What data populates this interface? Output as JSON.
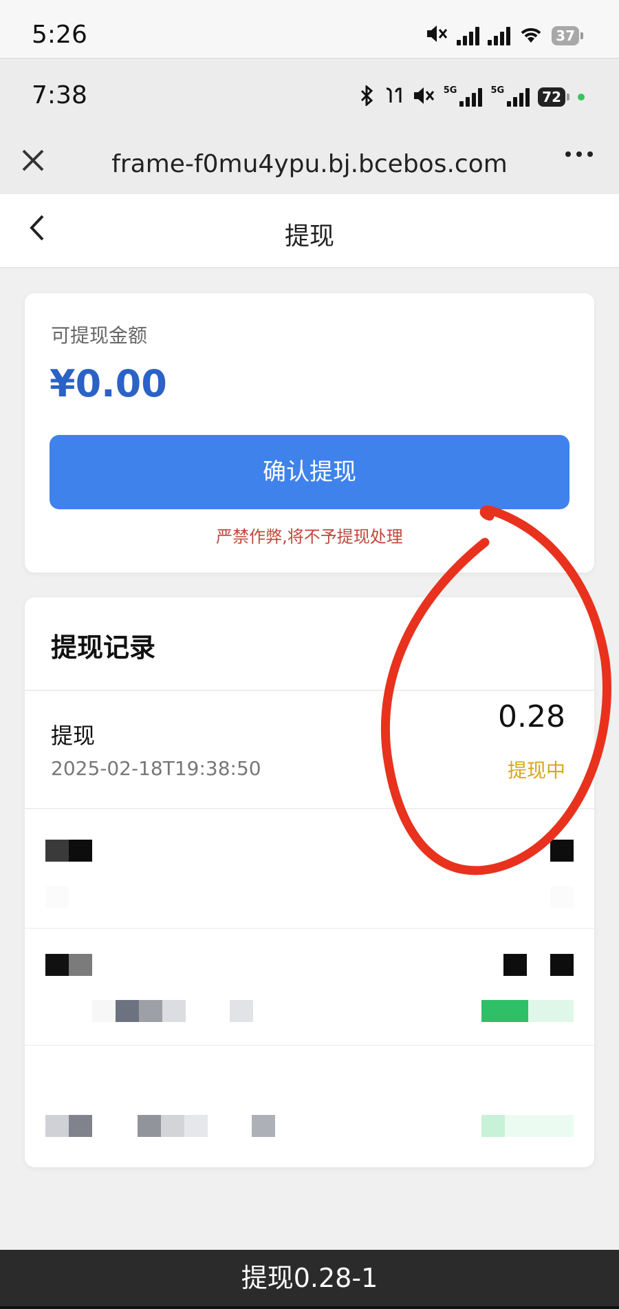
{
  "outer_status": {
    "time": "5:26",
    "battery": "37"
  },
  "inner_status": {
    "time": "7:38",
    "battery": "72",
    "network_1": "5G",
    "network_2": "5G"
  },
  "browser": {
    "url": "frame-f0mu4ypu.bj.bcebos.com",
    "more_icon": "more-icon",
    "close_icon": "close-icon"
  },
  "page": {
    "title": "提现",
    "back_icon": "chevron-left-icon"
  },
  "balance": {
    "label": "可提现金额",
    "amount": "¥0.00",
    "confirm_label": "确认提现",
    "warning": "严禁作弊,将不予提现处理"
  },
  "records": {
    "title": "提现记录",
    "items": [
      {
        "label": "提现",
        "time": "2025-02-18T19:38:50",
        "amount": "0.28",
        "status": "提现中"
      }
    ]
  },
  "caption": "提现0.28-1",
  "colors": {
    "accent": "#3f82ec",
    "amount": "#2b62c6",
    "warning": "#c1473a",
    "pending": "#d9a619",
    "annotation": "#e8321e"
  }
}
